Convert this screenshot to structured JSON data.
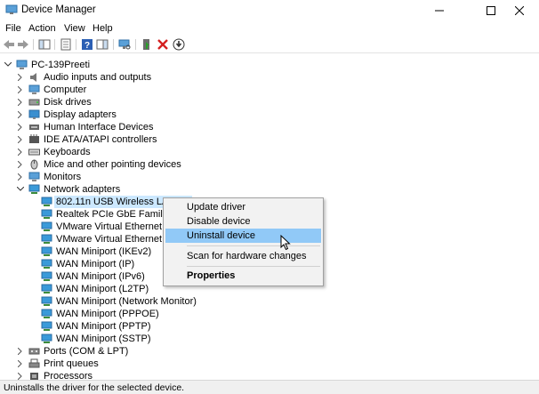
{
  "window": {
    "title": "Device Manager"
  },
  "menubar": {
    "items": [
      "File",
      "Action",
      "View",
      "Help"
    ]
  },
  "tree": {
    "root": "PC-139Preeti",
    "categories": [
      {
        "label": "Audio inputs and outputs",
        "icon": "speaker-icon"
      },
      {
        "label": "Computer",
        "icon": "computer-icon"
      },
      {
        "label": "Disk drives",
        "icon": "disk-drive-icon"
      },
      {
        "label": "Display adapters",
        "icon": "display-adapter-icon"
      },
      {
        "label": "Human Interface Devices",
        "icon": "hid-icon"
      },
      {
        "label": "IDE ATA/ATAPI controllers",
        "icon": "ide-controller-icon"
      },
      {
        "label": "Keyboards",
        "icon": "keyboard-icon"
      },
      {
        "label": "Mice and other pointing devices",
        "icon": "mouse-icon"
      },
      {
        "label": "Monitors",
        "icon": "monitor-icon"
      },
      {
        "label": "Network adapters",
        "icon": "network-adapter-icon"
      }
    ],
    "network_adapters": [
      "802.11n USB Wireless LAN Ca",
      "Realtek PCIe GbE Family Con",
      "VMware Virtual Ethernet Adap",
      "VMware Virtual Ethernet Adap",
      "WAN Miniport (IKEv2)",
      "WAN Miniport (IP)",
      "WAN Miniport (IPv6)",
      "WAN Miniport (L2TP)",
      "WAN Miniport (Network Monitor)",
      "WAN Miniport (PPPOE)",
      "WAN Miniport (PPTP)",
      "WAN Miniport (SSTP)"
    ],
    "after": [
      {
        "label": "Ports (COM & LPT)",
        "icon": "port-icon"
      },
      {
        "label": "Print queues",
        "icon": "printer-icon"
      },
      {
        "label": "Processors",
        "icon": "processor-icon"
      }
    ]
  },
  "context_menu": {
    "update_driver": "Update driver",
    "disable_device": "Disable device",
    "uninstall_device": "Uninstall device",
    "scan_changes": "Scan for hardware changes",
    "properties": "Properties"
  },
  "status": {
    "text": "Uninstalls the driver for the selected device."
  },
  "colors": {
    "selection": "#cce8ff",
    "menu_highlight": "#91c9f7",
    "remove_icon": "#d42020",
    "network_icon": "#3a9ad9"
  }
}
